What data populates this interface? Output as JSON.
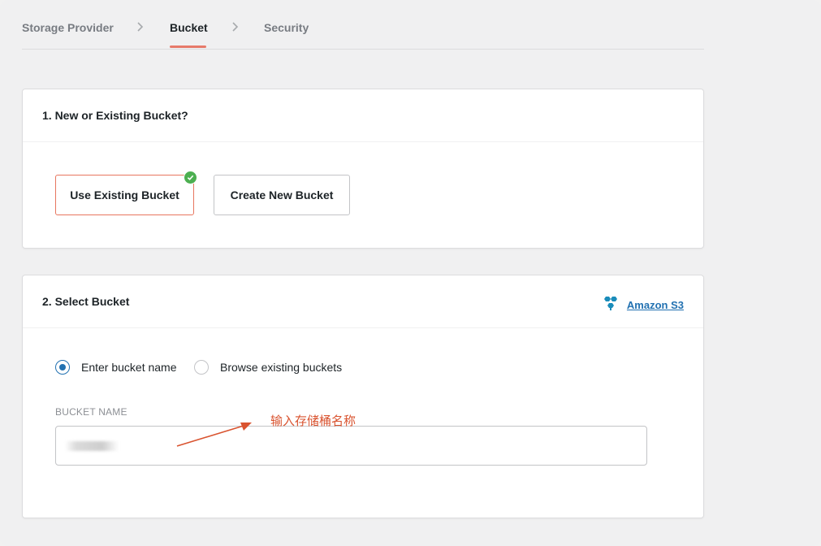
{
  "steps": [
    {
      "label": "Storage Provider",
      "active": false
    },
    {
      "label": "Bucket",
      "active": true
    },
    {
      "label": "Security",
      "active": false
    }
  ],
  "section1": {
    "title": "1. New or Existing Bucket?",
    "options": [
      {
        "label": "Use Existing Bucket",
        "selected": true
      },
      {
        "label": "Create New Bucket",
        "selected": false
      }
    ]
  },
  "section2": {
    "title": "2. Select Bucket",
    "provider": {
      "icon": "aws-s3-icon",
      "label": "Amazon S3"
    },
    "radios": [
      {
        "label": "Enter bucket name",
        "checked": true
      },
      {
        "label": "Browse existing buckets",
        "checked": false
      }
    ],
    "field_label": "BUCKET NAME",
    "field_value": ""
  },
  "annotation": {
    "text": "输入存储桶名称"
  },
  "colors": {
    "accent": "#e7765f",
    "link": "#2271b1",
    "check": "#4caf50",
    "annotation": "#d9532f"
  }
}
